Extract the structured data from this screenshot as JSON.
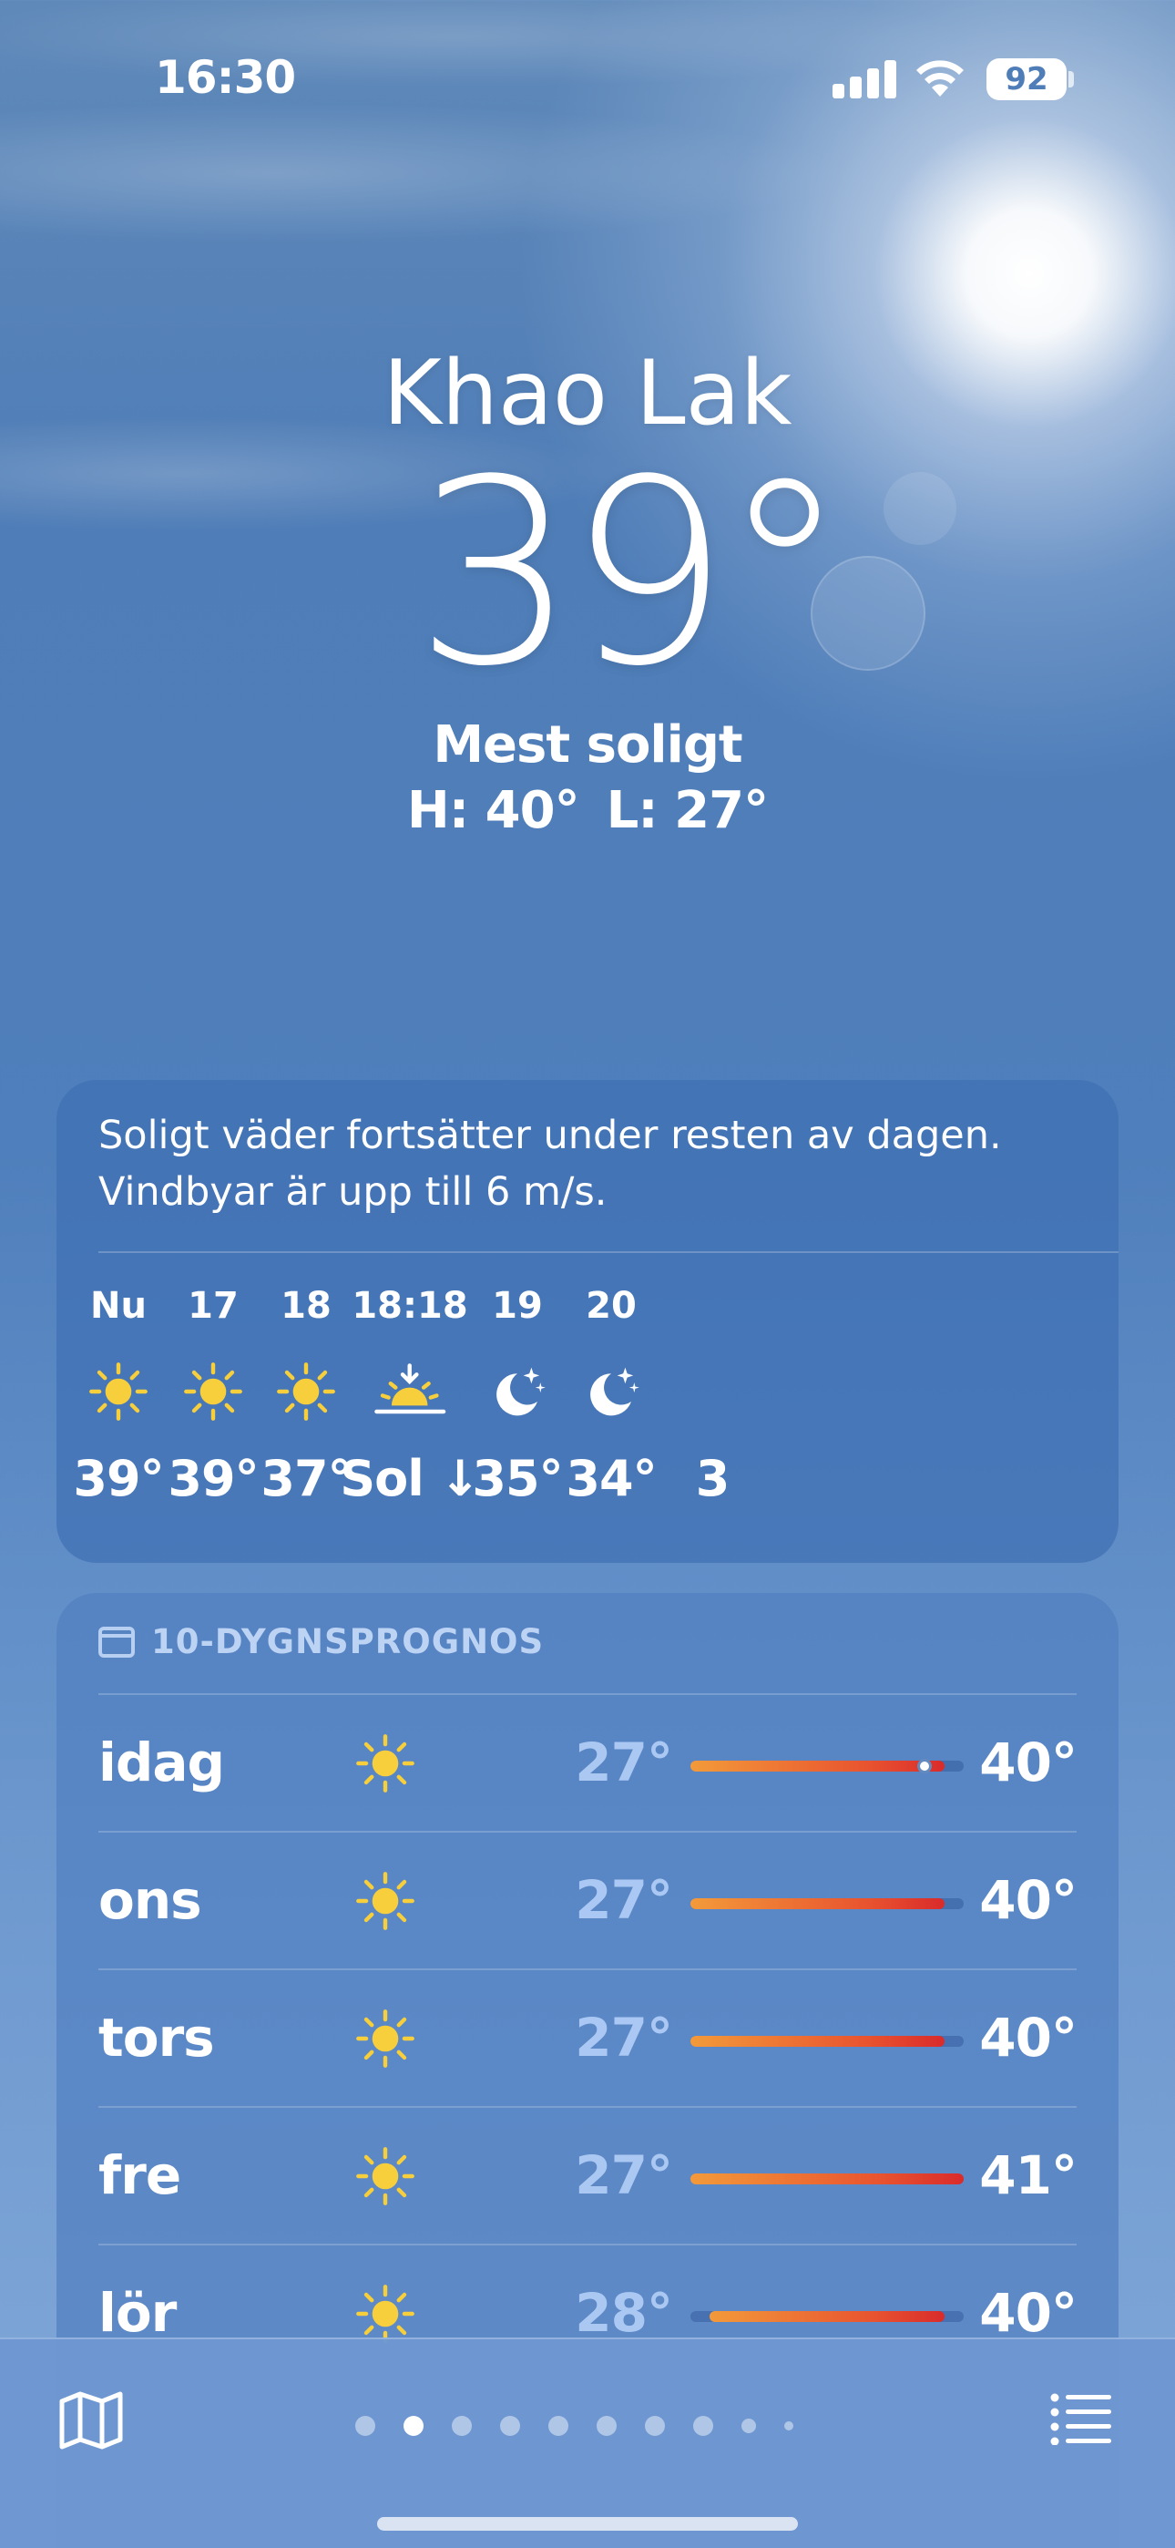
{
  "status_bar": {
    "time": "16:30",
    "battery": "92",
    "icons": [
      "cellular-signal-icon",
      "wifi-icon",
      "battery-icon"
    ]
  },
  "location": {
    "city": "Khao Lak",
    "temperature": "39°",
    "condition": "Mest soligt",
    "high": "H: 40°",
    "low": "L: 27°"
  },
  "hourly": {
    "summary": "Soligt väder fortsätter under resten av dagen. Vindbyar är upp till 6 m/s.",
    "items": [
      {
        "label": "Nu",
        "icon": "sun-icon",
        "value": "39°"
      },
      {
        "label": "17",
        "icon": "sun-icon",
        "value": "39°"
      },
      {
        "label": "18",
        "icon": "sun-icon",
        "value": "37°"
      },
      {
        "label": "18:18",
        "icon": "sunset-icon",
        "value": "Sol ↓"
      },
      {
        "label": "19",
        "icon": "moon-stars-icon",
        "value": "35°"
      },
      {
        "label": "20",
        "icon": "moon-stars-icon",
        "value": "34°"
      },
      {
        "label": "",
        "icon": "",
        "value": "3"
      }
    ]
  },
  "daily": {
    "title": "10-DYGNSPROGNOS",
    "title_icon": "calendar-icon",
    "range_min": 27,
    "range_max": 41,
    "rows": [
      {
        "day": "idag",
        "icon": "sun-icon",
        "low": "27°",
        "high": "40°",
        "low_val": 27,
        "high_val": 40,
        "current": 39
      },
      {
        "day": "ons",
        "icon": "sun-icon",
        "low": "27°",
        "high": "40°",
        "low_val": 27,
        "high_val": 40
      },
      {
        "day": "tors",
        "icon": "sun-icon",
        "low": "27°",
        "high": "40°",
        "low_val": 27,
        "high_val": 40
      },
      {
        "day": "fre",
        "icon": "sun-icon",
        "low": "27°",
        "high": "41°",
        "low_val": 27,
        "high_val": 41
      },
      {
        "day": "lör",
        "icon": "sun-icon",
        "low": "28°",
        "high": "40°",
        "low_val": 28,
        "high_val": 40
      }
    ]
  },
  "toolbar": {
    "map_icon": "map-icon",
    "list_icon": "list-icon",
    "page_count": 10,
    "active_page": 1
  },
  "colors": {
    "sun": "#f7cf3c",
    "bar_gradient_start": "#f39a3a",
    "bar_gradient_end": "#d92b2b"
  }
}
